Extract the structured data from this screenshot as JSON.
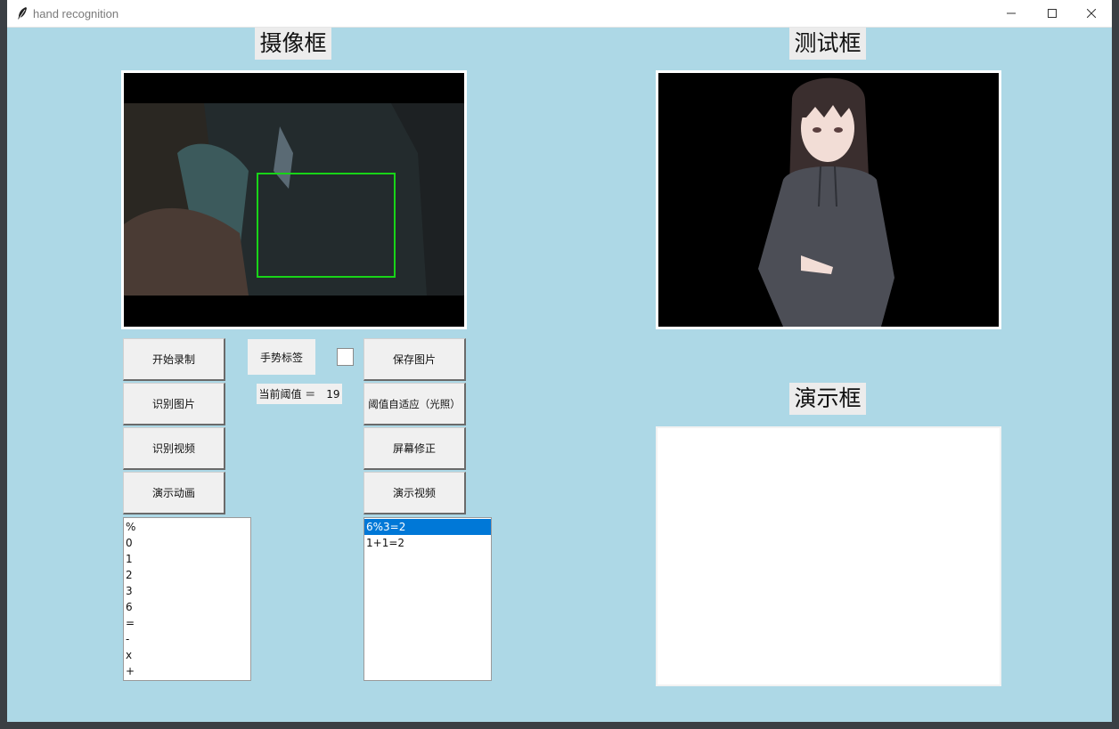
{
  "window": {
    "title": "hand recognition",
    "icon": "feather-icon",
    "controls": [
      "minimize-icon",
      "maximize-icon",
      "close-icon"
    ]
  },
  "headings": {
    "camera": "摄像框",
    "test": "测试框",
    "demo": "演示框"
  },
  "buttons": {
    "start_record": "开始录制",
    "recognize_image": "识别图片",
    "recognize_video": "识别视频",
    "demo_animation": "演示动画",
    "save_image": "保存图片",
    "adaptive_threshold": "阈值自适应（光照）",
    "screen_correct": "屏幕修正",
    "demo_video": "演示视频"
  },
  "gesture_label": "手势标签",
  "threshold": {
    "label": "当前阈值 ＝",
    "value": "19"
  },
  "gesture_list": [
    "%",
    "0",
    "1",
    "2",
    "3",
    "6",
    "=",
    "-",
    "x",
    "+"
  ],
  "result_list": {
    "items": [
      "6%3=2",
      "1+1=2"
    ],
    "selected_index": 0
  },
  "colors": {
    "background": "#add8e6",
    "detection_box": "#18d418",
    "selection": "#0078d7"
  }
}
